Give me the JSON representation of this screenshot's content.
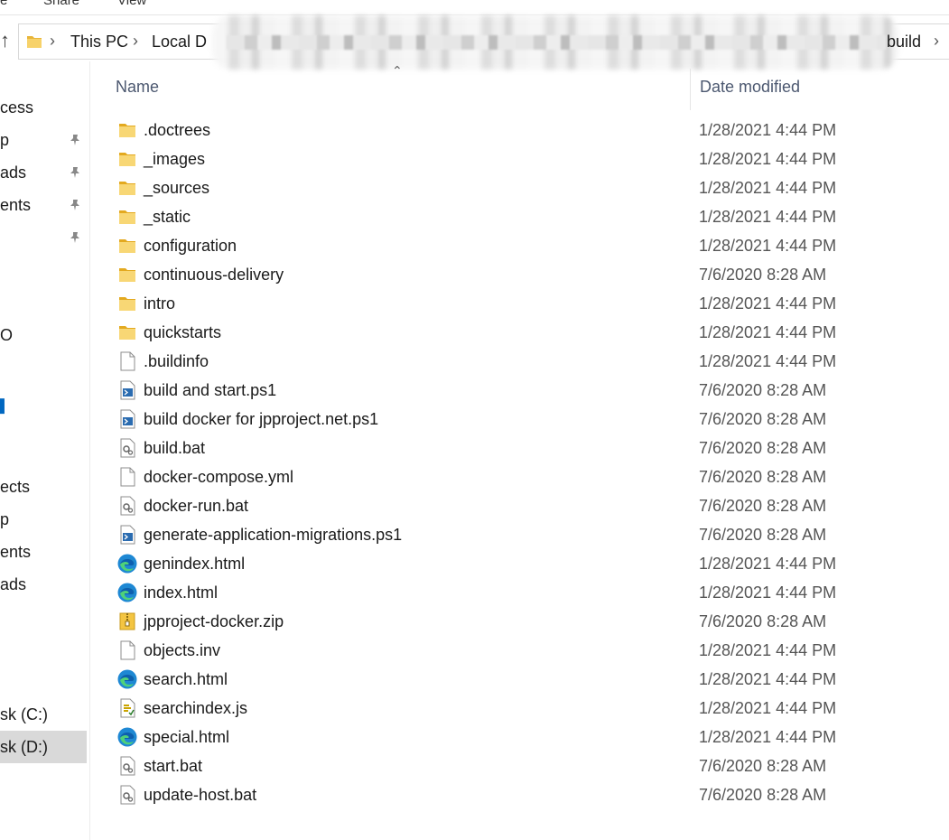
{
  "ribbon": {
    "tabs": [
      "e",
      "Share",
      "View"
    ]
  },
  "address": {
    "crumbs": [
      "This PC",
      "Local D"
    ],
    "last_crumb": "build"
  },
  "nav": {
    "items": [
      {
        "label": "cess",
        "pinned": false
      },
      {
        "label": "p",
        "pinned": true
      },
      {
        "label": "ads",
        "pinned": true
      },
      {
        "label": "ents",
        "pinned": true
      },
      {
        "label": "",
        "pinned": true
      },
      {
        "label": "O",
        "pinned": false
      },
      {
        "label": "ects",
        "pinned": false
      },
      {
        "label": "p",
        "pinned": false
      },
      {
        "label": "ents",
        "pinned": false
      },
      {
        "label": "ads",
        "pinned": false
      },
      {
        "label": "sk (C:)",
        "pinned": false
      },
      {
        "label": "sk (D:)",
        "pinned": false,
        "selected": true
      }
    ]
  },
  "columns": {
    "name": "Name",
    "date_modified": "Date modified"
  },
  "files": [
    {
      "name": ".doctrees",
      "date": "1/28/2021 4:44 PM",
      "icon": "folder-icon"
    },
    {
      "name": "_images",
      "date": "1/28/2021 4:44 PM",
      "icon": "folder-icon"
    },
    {
      "name": "_sources",
      "date": "1/28/2021 4:44 PM",
      "icon": "folder-icon"
    },
    {
      "name": "_static",
      "date": "1/28/2021 4:44 PM",
      "icon": "folder-icon"
    },
    {
      "name": "configuration",
      "date": "1/28/2021 4:44 PM",
      "icon": "folder-icon"
    },
    {
      "name": "continuous-delivery",
      "date": "7/6/2020 8:28 AM",
      "icon": "folder-icon"
    },
    {
      "name": "intro",
      "date": "1/28/2021 4:44 PM",
      "icon": "folder-icon"
    },
    {
      "name": "quickstarts",
      "date": "1/28/2021 4:44 PM",
      "icon": "folder-icon"
    },
    {
      "name": ".buildinfo",
      "date": "1/28/2021 4:44 PM",
      "icon": "file-icon"
    },
    {
      "name": "build and start.ps1",
      "date": "7/6/2020 8:28 AM",
      "icon": "powershell-file-icon"
    },
    {
      "name": "build docker for jpproject.net.ps1",
      "date": "7/6/2020 8:28 AM",
      "icon": "powershell-file-icon"
    },
    {
      "name": "build.bat",
      "date": "7/6/2020 8:28 AM",
      "icon": "batch-file-icon"
    },
    {
      "name": "docker-compose.yml",
      "date": "7/6/2020 8:28 AM",
      "icon": "file-icon"
    },
    {
      "name": "docker-run.bat",
      "date": "7/6/2020 8:28 AM",
      "icon": "batch-file-icon"
    },
    {
      "name": "generate-application-migrations.ps1",
      "date": "7/6/2020 8:28 AM",
      "icon": "powershell-file-icon"
    },
    {
      "name": "genindex.html",
      "date": "1/28/2021 4:44 PM",
      "icon": "edge-html-icon"
    },
    {
      "name": "index.html",
      "date": "1/28/2021 4:44 PM",
      "icon": "edge-html-icon"
    },
    {
      "name": "jpproject-docker.zip",
      "date": "7/6/2020 8:28 AM",
      "icon": "zip-file-icon"
    },
    {
      "name": "objects.inv",
      "date": "1/28/2021 4:44 PM",
      "icon": "file-icon"
    },
    {
      "name": "search.html",
      "date": "1/28/2021 4:44 PM",
      "icon": "edge-html-icon"
    },
    {
      "name": "searchindex.js",
      "date": "1/28/2021 4:44 PM",
      "icon": "script-file-icon"
    },
    {
      "name": "special.html",
      "date": "1/28/2021 4:44 PM",
      "icon": "edge-html-icon"
    },
    {
      "name": "start.bat",
      "date": "7/6/2020 8:28 AM",
      "icon": "batch-file-icon"
    },
    {
      "name": "update-host.bat",
      "date": "7/6/2020 8:28 AM",
      "icon": "batch-file-icon"
    }
  ]
}
